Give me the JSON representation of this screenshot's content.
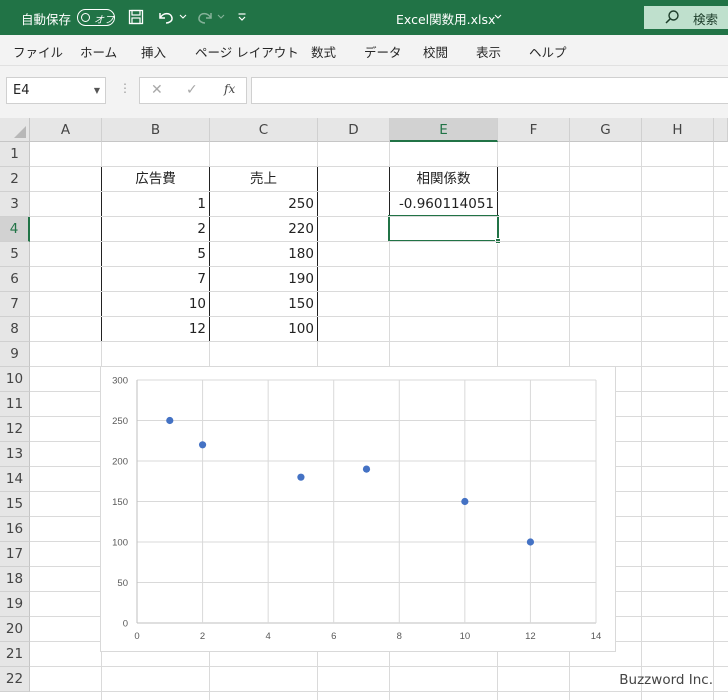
{
  "titlebar": {
    "autosave_label": "自動保存",
    "autosave_toggle": "オフ",
    "filename": "Excel関数用.xlsx",
    "search_label": "検索"
  },
  "ribbon": {
    "tabs": [
      "ファイル",
      "ホーム",
      "挿入",
      "ページ レイアウト",
      "数式",
      "データ",
      "校閲",
      "表示",
      "ヘルプ"
    ]
  },
  "formula_bar": {
    "name_box": "E4",
    "fx_label": "fx",
    "formula": ""
  },
  "sheet": {
    "columns": [
      "A",
      "B",
      "C",
      "D",
      "E",
      "F",
      "G",
      "H"
    ],
    "rows": [
      "1",
      "2",
      "3",
      "4",
      "5",
      "6",
      "7",
      "8",
      "9",
      "10",
      "11",
      "12",
      "13",
      "14",
      "15",
      "16",
      "17",
      "18",
      "19",
      "20",
      "21",
      "22"
    ],
    "selected_cell": "E4",
    "table": {
      "headers": [
        "広告費",
        "売上"
      ],
      "rows": [
        [
          "1",
          "250"
        ],
        [
          "2",
          "220"
        ],
        [
          "5",
          "180"
        ],
        [
          "7",
          "190"
        ],
        [
          "10",
          "150"
        ],
        [
          "12",
          "100"
        ]
      ]
    },
    "correlation": {
      "header": "相関係数",
      "value": "-0.960114051"
    }
  },
  "chart_data": {
    "type": "scatter",
    "x": [
      1,
      2,
      5,
      7,
      10,
      12
    ],
    "y": [
      250,
      220,
      180,
      190,
      150,
      100
    ],
    "xlim": [
      0,
      14
    ],
    "ylim": [
      0,
      300
    ],
    "xticks": [
      "0",
      "2",
      "4",
      "6",
      "8",
      "10",
      "12",
      "14"
    ],
    "yticks": [
      "0",
      "50",
      "100",
      "150",
      "200",
      "250",
      "300"
    ],
    "grid": true,
    "title": "",
    "xlabel": "",
    "ylabel": "",
    "marker_color": "#4472c4"
  },
  "watermark": "Buzzword Inc.",
  "colors": {
    "excel_green": "#217346",
    "marker": "#4472c4"
  }
}
